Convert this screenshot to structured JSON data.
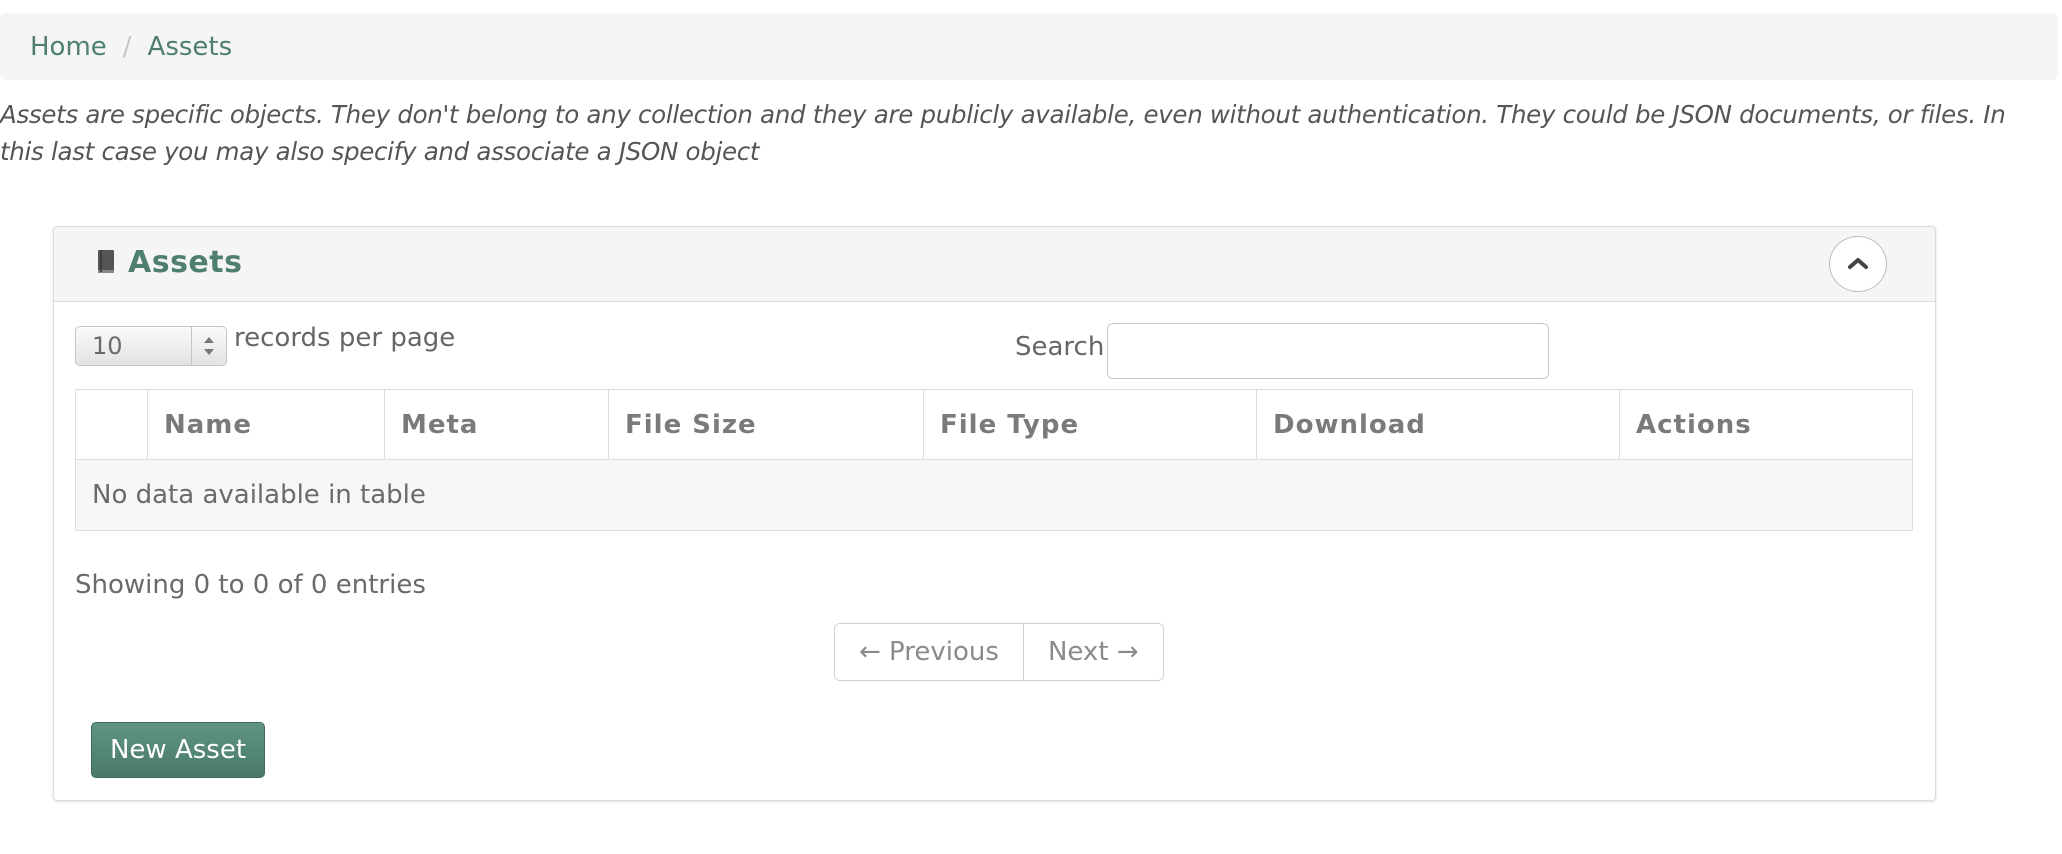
{
  "breadcrumb": {
    "home": "Home",
    "separator": "/",
    "current": "Assets"
  },
  "intro_text": "Assets are specific objects. They don't belong to any collection and they are publicly available, even without authentication. They could be JSON documents, or files. In this last case you may also specify and associate a JSON object",
  "panel": {
    "title": "Assets",
    "icon": "book-icon",
    "collapse_icon": "chevron-up-icon"
  },
  "table_controls": {
    "page_length": "10",
    "records_label": "records per page",
    "search_label": "Search:",
    "search_value": ""
  },
  "table": {
    "columns": [
      "",
      "Name",
      "Meta",
      "File Size",
      "File Type",
      "Download",
      "Actions"
    ],
    "empty_message": "No data available in table"
  },
  "info_text": "Showing 0 to 0 of 0 entries",
  "pagination": {
    "previous": "← Previous",
    "next": "Next →"
  },
  "actions": {
    "new_asset": "New Asset"
  },
  "colors": {
    "accent": "#4f7f70",
    "button": "#548673"
  }
}
